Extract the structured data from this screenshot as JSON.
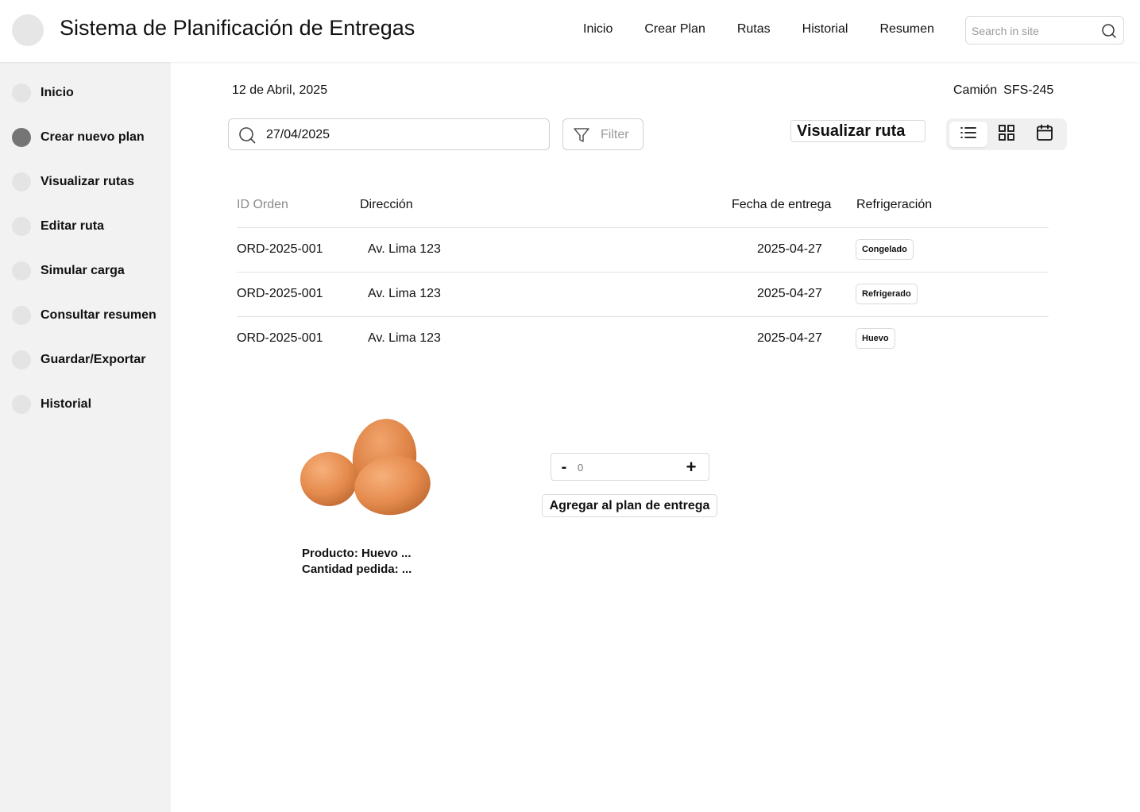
{
  "header": {
    "title": "Sistema de Planificación de Entregas",
    "nav": [
      "Inicio",
      "Crear Plan",
      "Rutas",
      "Historial",
      "Resumen"
    ],
    "search_placeholder": "Search in site"
  },
  "sidebar": {
    "active_index": 1,
    "items": [
      {
        "label": "Inicio"
      },
      {
        "label": "Crear nuevo plan"
      },
      {
        "label": "Visualizar rutas"
      },
      {
        "label": "Editar ruta"
      },
      {
        "label": "Simular carga"
      },
      {
        "label": "Consultar resumen"
      },
      {
        "label": "Guardar/Exportar"
      },
      {
        "label": "Historial"
      }
    ]
  },
  "main": {
    "date": "12 de Abril, 2025",
    "truck_label": "Camión",
    "truck_id": "SFS-245",
    "date_search_value": "27/04/2025",
    "filter_label": "Filter",
    "route_button": "Visualizar ruta",
    "view_modes": [
      "list-icon",
      "grid-icon",
      "calendar-icon"
    ],
    "active_view": 0
  },
  "table": {
    "headers": {
      "id": "ID Orden",
      "address": "Dirección",
      "date": "Fecha de entrega",
      "refrigeration": "Refrigeración"
    },
    "rows": [
      {
        "id": "ORD-2025-001",
        "address": "Av. Lima 123",
        "date": "2025-04-27",
        "refrigeration": "Congelado"
      },
      {
        "id": "ORD-2025-001",
        "address": "Av. Lima 123",
        "date": "2025-04-27",
        "refrigeration": "Refrigerado"
      },
      {
        "id": "ORD-2025-001",
        "address": "Av. Lima 123",
        "date": "2025-04-27",
        "refrigeration": "Huevo"
      }
    ]
  },
  "product": {
    "image_icon": "eggs-image",
    "name_line": "Producto: Huevo ...",
    "qty_line": "Cantidad pedida: ...",
    "stepper_minus": "-",
    "stepper_plus": "+",
    "stepper_value": "0",
    "add_button": "Agregar al plan de entrega"
  },
  "colors": {
    "sidebar_bg": "#f2f2f2",
    "active_dot": "#757575",
    "inactive_dot": "#e4e4e4",
    "egg": "#e58b4e"
  }
}
